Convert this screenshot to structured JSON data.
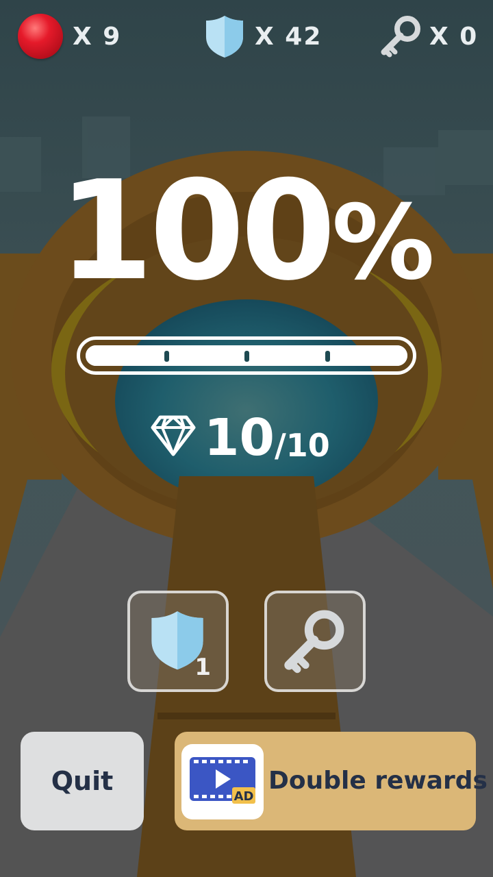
{
  "hud": {
    "balls": {
      "icon": "red-ball-icon",
      "label": "X 9"
    },
    "shields": {
      "icon": "shield-icon",
      "label": "X 42"
    },
    "keys": {
      "icon": "key-icon",
      "label": "X 0"
    }
  },
  "level": {
    "percent_number": "100",
    "percent_sign": "%",
    "progress_fraction": 1.0,
    "progress_markers": 3
  },
  "gems": {
    "icon": "diamond-icon",
    "collected": "10",
    "separator": "/",
    "total": "10"
  },
  "powerups": {
    "shield": {
      "icon": "shield-icon",
      "count": "1"
    },
    "key": {
      "icon": "key-icon"
    }
  },
  "buttons": {
    "quit_label": "Quit",
    "double_label": "Double rewards",
    "ad_icon": "video-ad-icon",
    "ad_text": "AD"
  },
  "colors": {
    "ball": "#e51a2a",
    "shield": "#a9d8ee",
    "double_button": "#dbb777",
    "quit_button": "#dedfe0",
    "button_text": "#243047",
    "ad_icon_blue": "#3b56c4",
    "ad_badge_yellow": "#f2c04b"
  }
}
